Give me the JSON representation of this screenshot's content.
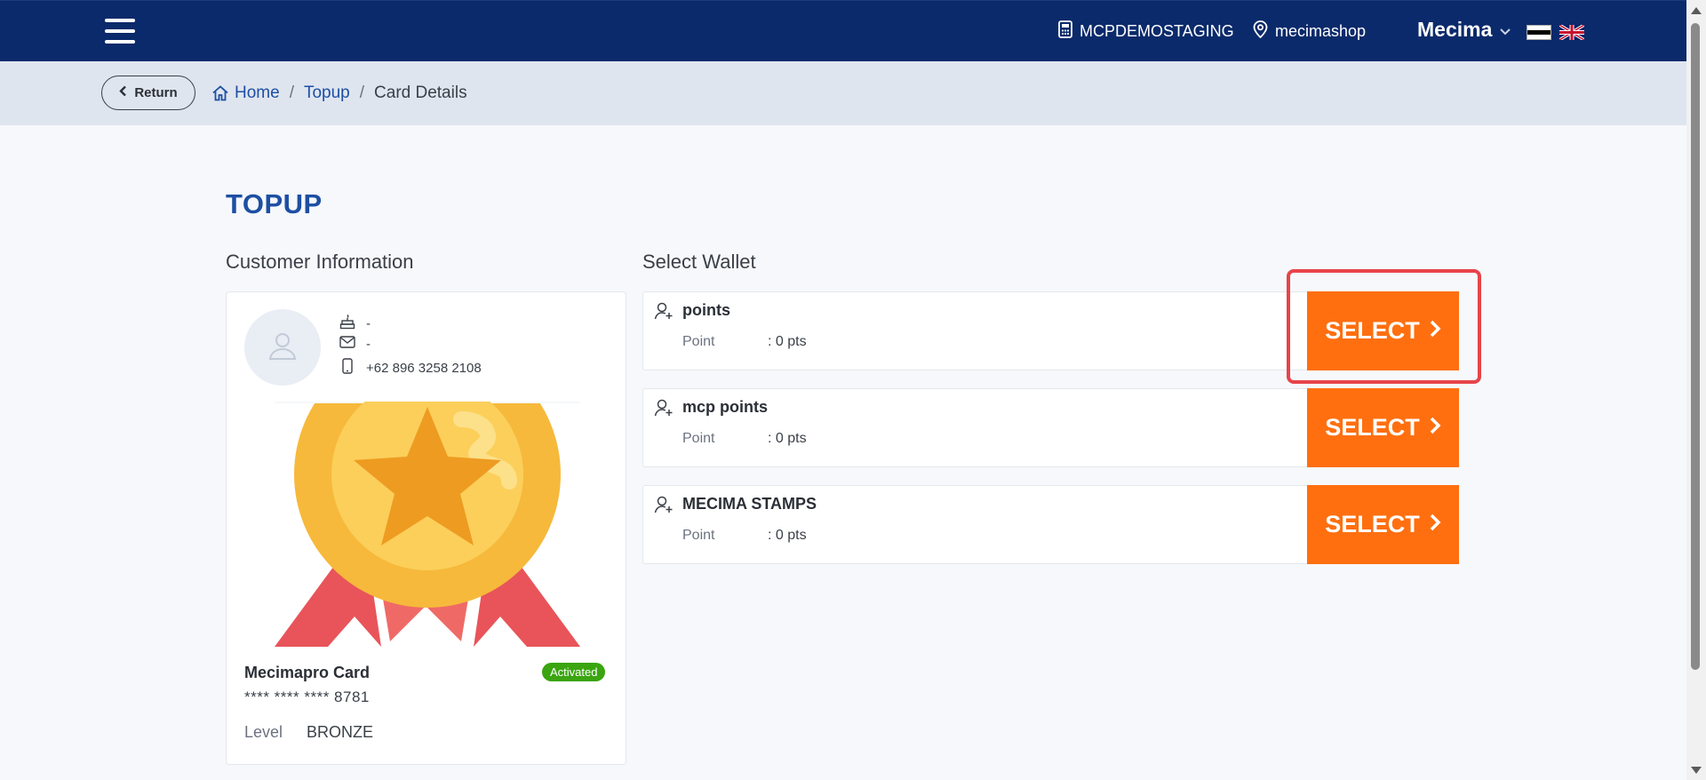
{
  "header": {
    "organization": "MCPDEMOSTAGING",
    "shop": "mecimashop",
    "user": "Mecima",
    "icons": [
      "menu-icon",
      "calculator-icon",
      "location-pin-icon",
      "chevron-down-icon",
      "estonia-flag-icon",
      "uk-flag-icon"
    ]
  },
  "breadcrumb": {
    "return_label": "Return",
    "home": "Home",
    "topup": "Topup",
    "current": "Card Details"
  },
  "page": {
    "title": "TOPUP",
    "customer_section": "Customer Information",
    "wallet_section": "Select Wallet"
  },
  "customer": {
    "birthday": "-",
    "email": "-",
    "phone": "+62 896 3258 2108",
    "card_name": "Mecimapro Card",
    "status": "Activated",
    "card_number": "**** **** **** 8781",
    "level_label": "Level",
    "level": "BRONZE"
  },
  "wallets": [
    {
      "name": "points",
      "point_label": "Point",
      "point_value": ": 0 pts",
      "button": "SELECT"
    },
    {
      "name": "mcp points",
      "point_label": "Point",
      "point_value": ": 0 pts",
      "button": "SELECT"
    },
    {
      "name": "MECIMA STAMPS",
      "point_label": "Point",
      "point_value": ": 0 pts",
      "button": "SELECT"
    }
  ],
  "colors": {
    "navbar": "#0b2a6b",
    "accent_blue": "#1d4fa3",
    "select_orange": "#ff6f0f",
    "activated_green": "#3aa510",
    "highlight_red": "#e8434a"
  }
}
